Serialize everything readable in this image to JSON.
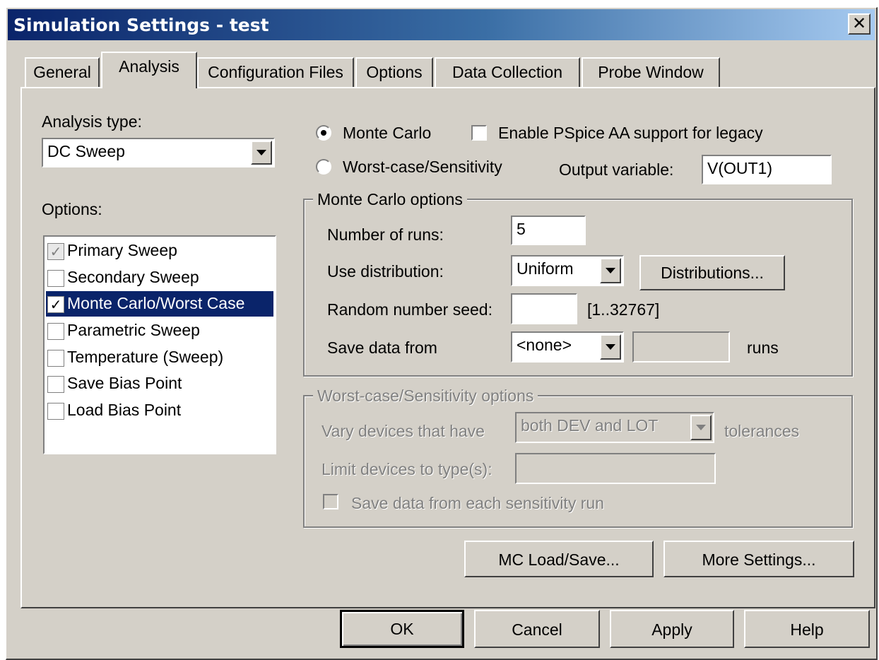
{
  "window": {
    "title": "Simulation Settings - test",
    "close_glyph": "✕"
  },
  "tabs": [
    {
      "label": "General",
      "active": false
    },
    {
      "label": "Analysis",
      "active": true
    },
    {
      "label": "Configuration Files",
      "active": false
    },
    {
      "label": "Options",
      "active": false
    },
    {
      "label": "Data Collection",
      "active": false
    },
    {
      "label": "Probe Window",
      "active": false
    }
  ],
  "analysis": {
    "type_label": "Analysis type:",
    "type_value": "DC Sweep",
    "options_label": "Options:",
    "options": [
      {
        "label": "Primary Sweep",
        "checked": true,
        "grayed": true,
        "selected": false
      },
      {
        "label": "Secondary Sweep",
        "checked": false,
        "grayed": false,
        "selected": false
      },
      {
        "label": "Monte Carlo/Worst Case",
        "checked": true,
        "grayed": false,
        "selected": true
      },
      {
        "label": "Parametric Sweep",
        "checked": false,
        "grayed": false,
        "selected": false
      },
      {
        "label": "Temperature (Sweep)",
        "checked": false,
        "grayed": false,
        "selected": false
      },
      {
        "label": "Save Bias Point",
        "checked": false,
        "grayed": false,
        "selected": false
      },
      {
        "label": "Load Bias Point",
        "checked": false,
        "grayed": false,
        "selected": false
      }
    ]
  },
  "mode": {
    "monte_carlo_label": "Monte Carlo",
    "monte_carlo_selected": true,
    "worst_case_label": "Worst-case/Sensitivity",
    "worst_case_selected": false,
    "legacy_label": "Enable PSpice AA support for legacy",
    "legacy_checked": false,
    "output_variable_label": "Output variable:",
    "output_variable_value": "V(OUT1)"
  },
  "monte_carlo_options": {
    "group_label": "Monte Carlo options",
    "runs_label": "Number of runs:",
    "runs_value": "5",
    "distribution_label": "Use distribution:",
    "distribution_value": "Uniform",
    "distributions_button": "Distributions...",
    "seed_label": "Random number seed:",
    "seed_value": "",
    "seed_range": "[1..32767]",
    "save_label": "Save data from",
    "save_value": "<none>",
    "save_runs_value": "",
    "runs_suffix": "runs"
  },
  "worst_case_options": {
    "group_label": "Worst-case/Sensitivity options",
    "vary_label": "Vary devices that have",
    "vary_value": "both DEV and LOT",
    "tolerances_suffix": "tolerances",
    "limit_label": "Limit devices to type(s):",
    "limit_value": "",
    "save_each_label": "Save data from each sensitivity run",
    "save_each_checked": false
  },
  "panel_buttons": {
    "mc_load_save": "MC Load/Save...",
    "more_settings": "More Settings..."
  },
  "footer": {
    "ok": "OK",
    "cancel": "Cancel",
    "apply": "Apply",
    "help": "Help"
  }
}
